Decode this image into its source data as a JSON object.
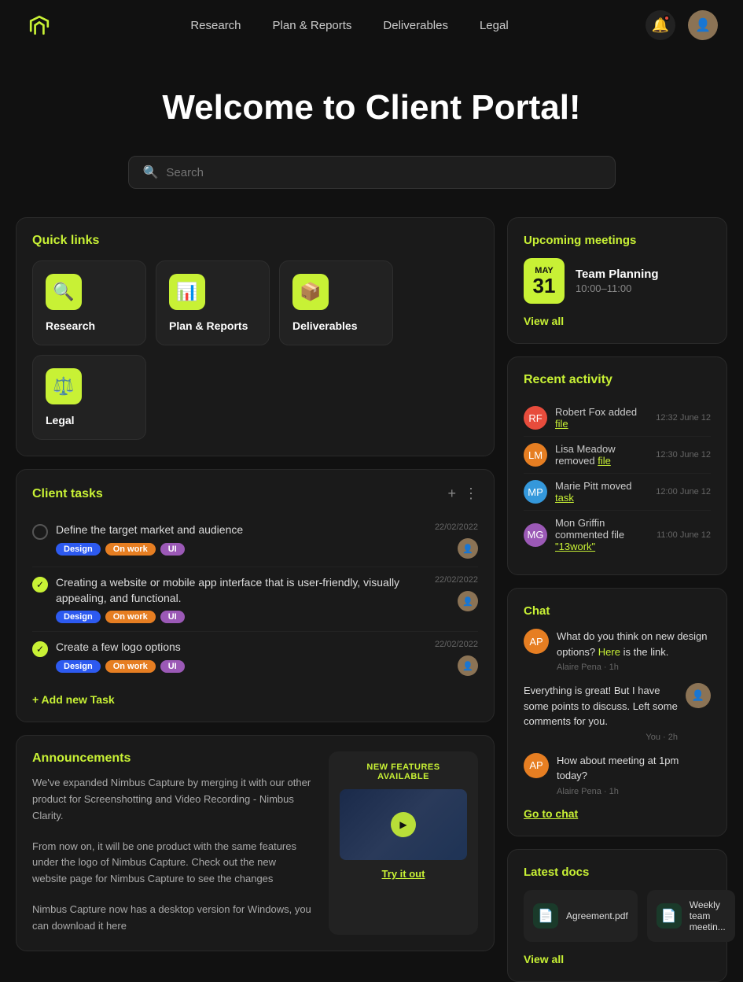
{
  "nav": {
    "logo_alt": "Nimbus Logo",
    "links": [
      {
        "label": "Research",
        "href": "#"
      },
      {
        "label": "Plan & Reports",
        "href": "#"
      },
      {
        "label": "Deliverables",
        "href": "#"
      },
      {
        "label": "Legal",
        "href": "#"
      }
    ],
    "bell_label": "Notifications",
    "avatar_label": "User Avatar"
  },
  "hero": {
    "title": "Welcome to Client Portal!"
  },
  "search": {
    "placeholder": "Search"
  },
  "quick_links": {
    "title": "Quick links",
    "items": [
      {
        "label": "Research",
        "icon": "🔍"
      },
      {
        "label": "Plan & Reports",
        "icon": "📊"
      },
      {
        "label": "Deliverables",
        "icon": "📦"
      },
      {
        "label": "Legal",
        "icon": "⚖️"
      }
    ]
  },
  "upcoming_meetings": {
    "title": "Upcoming meetings",
    "meeting": {
      "month": "May",
      "day": "31",
      "name": "Team Planning",
      "time": "10:00–11:00"
    },
    "view_all": "View all"
  },
  "client_tasks": {
    "title": "Client tasks",
    "add_label": "+ Add new Task",
    "tasks": [
      {
        "done": false,
        "text": "Define the target market and audience",
        "tags": [
          "Design",
          "On work",
          "UI"
        ],
        "date": "22/02/2022"
      },
      {
        "done": true,
        "text": "Creating a website or mobile app interface that is user-friendly, visually appealing, and functional.",
        "tags": [
          "Design",
          "On work",
          "UI"
        ],
        "date": "22/02/2022"
      },
      {
        "done": true,
        "text": "Create a few logo options",
        "tags": [
          "Design",
          "On work",
          "UI"
        ],
        "date": "22/02/2022"
      }
    ]
  },
  "announcements": {
    "title": "Announcements",
    "text1": "We've expanded Nimbus Capture by merging it with our other product for Screenshotting and Video Recording - Nimbus Clarity.",
    "text2": "From now on, it will be one product with the same features under the logo of Nimbus Capture. Check out the new website page for Nimbus Capture to see the changes",
    "text3": "Nimbus Capture now has a desktop version for Windows, you can download it here",
    "feature_label": "NEW FEATURES AVAILABLE",
    "try_it": "Try it out"
  },
  "recent_activity": {
    "title": "Recent activity",
    "items": [
      {
        "user": "Robert Fox",
        "action": "added",
        "link": "file",
        "time": "12:32 June 12",
        "color": "#e74c3c"
      },
      {
        "user": "Lisa Meadow",
        "action": "removed",
        "link": "file",
        "time": "12:30 June 12",
        "color": "#e67e22"
      },
      {
        "user": "Marie Pitt",
        "action": "moved",
        "link": "task",
        "time": "12:00 June 12",
        "color": "#3498db"
      },
      {
        "user": "Mon Griffin",
        "action": "commented file",
        "link": "\"13work\"",
        "time": "11:00 June 12",
        "color": "#9b59b6"
      }
    ]
  },
  "chat": {
    "title": "Chat",
    "messages": [
      {
        "sender": "Alaire Pena",
        "text": "What do you think on new design options? ",
        "link_text": "Here",
        "text2": " is the link.",
        "time": "Alaire Pena · 1h",
        "right": false,
        "color": "#e67e22"
      },
      {
        "sender": "You",
        "text": "Everything is great! But I have some points to discuss. Left some comments for you.",
        "time": "You · 2h",
        "right": true,
        "color": "#8B7355"
      },
      {
        "sender": "Alaire Pena",
        "text": "How about meeting at 1pm today?",
        "time": "Alaire Pena · 1h",
        "right": false,
        "color": "#e67e22"
      }
    ],
    "goto_label": "Go to chat"
  },
  "latest_docs": {
    "title": "Latest docs",
    "docs": [
      {
        "name": "Agreement.pdf",
        "icon": "📄"
      },
      {
        "name": "Weekly team meetin...",
        "icon": "📄"
      }
    ],
    "view_all": "View all"
  }
}
